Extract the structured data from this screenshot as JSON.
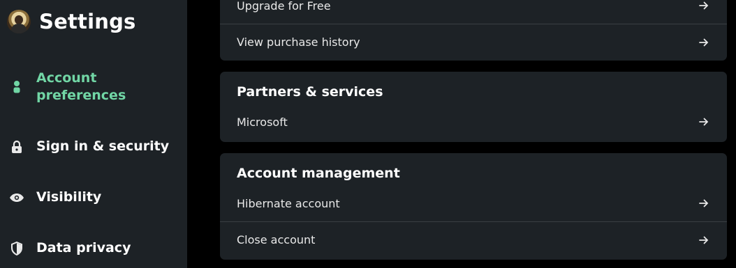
{
  "app": {
    "title": "Settings"
  },
  "sidebar": {
    "items": [
      {
        "label_line1": "Account",
        "label_line2": "preferences",
        "icon": "person-icon",
        "active": true
      },
      {
        "label": "Sign in & security",
        "icon": "lock-icon"
      },
      {
        "label": "Visibility",
        "icon": "eye-icon"
      },
      {
        "label": "Data privacy",
        "icon": "shield-icon"
      }
    ]
  },
  "main": {
    "top_card": {
      "rows": [
        {
          "label": "Upgrade for Free"
        },
        {
          "label": "View purchase history"
        }
      ]
    },
    "partners": {
      "title": "Partners & services",
      "rows": [
        {
          "label": "Microsoft"
        }
      ]
    },
    "account_management": {
      "title": "Account management",
      "rows": [
        {
          "label": "Hibernate account"
        },
        {
          "label": "Close account"
        }
      ]
    }
  },
  "colors": {
    "accent": "#71d6a5",
    "sidebar_bg": "#1d2226",
    "page_bg": "#000000",
    "card_bg": "#1d2226"
  }
}
